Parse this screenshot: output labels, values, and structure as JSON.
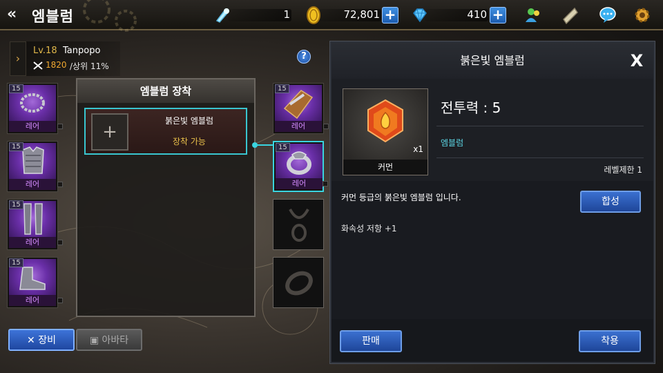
{
  "header": {
    "title": "엠블럼",
    "resources": [
      {
        "name": "energy",
        "value": "1",
        "icon": "energy-icon"
      },
      {
        "name": "gold",
        "value": "72,801",
        "icon": "gold-coin-icon"
      },
      {
        "name": "gems",
        "value": "410",
        "icon": "diamond-icon"
      }
    ],
    "icons": [
      "friends-icon",
      "mail-icon",
      "chat-icon",
      "settings-gear-icon"
    ]
  },
  "character": {
    "level": "Lv.18",
    "name": "Tanpopo",
    "power": "1820",
    "rank": "/상위 11%"
  },
  "left_slots": [
    {
      "level": "15",
      "grade": "레어",
      "icon": "necklace-chain-icon"
    },
    {
      "level": "15",
      "grade": "레어",
      "icon": "chest-armor-icon"
    },
    {
      "level": "15",
      "grade": "레어",
      "icon": "leg-armor-icon"
    },
    {
      "level": "15",
      "grade": "레어",
      "icon": "boots-icon"
    }
  ],
  "right_slots": [
    {
      "level": "15",
      "grade": "레어",
      "icon": "gauntlet-icon"
    },
    {
      "level": "15",
      "grade": "레어",
      "icon": "ring-icon"
    },
    {
      "level": "",
      "grade": "",
      "icon": "amulet-outline-icon"
    },
    {
      "level": "",
      "grade": "",
      "icon": "ring-outline-icon"
    }
  ],
  "equip_panel": {
    "title": "엠블럼 장착",
    "emblem": {
      "name": "붉은빛 엠블럼",
      "status": "장착 가능"
    }
  },
  "tabs": {
    "equipment": "장비",
    "avatar": "아바타"
  },
  "detail": {
    "title": "붉은빛 엠블럼",
    "quantity": "x1",
    "grade": "커먼",
    "power": "전투력 : 5",
    "type": "엠블럼",
    "level_limit": "레벨제한 1",
    "description": "커먼 등급의 붉은빛 엠블럼 입니다.",
    "stat": "화속성 저항 +1",
    "synth_button": "합성",
    "sell_button": "판매",
    "equip_button": "착용"
  },
  "colors": {
    "accent_cyan": "#39d4e0",
    "button_blue": "#2b5cc0",
    "rare_purple": "#6a2fa8",
    "gold_text": "#e9c04a"
  }
}
